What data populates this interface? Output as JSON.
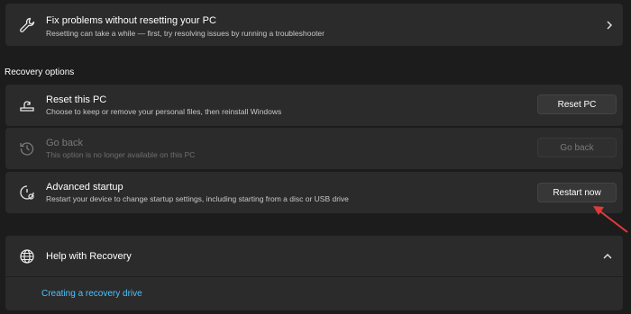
{
  "fix_problems": {
    "title": "Fix problems without resetting your PC",
    "subtitle": "Resetting can take a while — first, try resolving issues by running a troubleshooter",
    "icon": "wrench-icon"
  },
  "recovery_options_label": "Recovery options",
  "items": [
    {
      "title": "Reset this PC",
      "subtitle": "Choose to keep or remove your personal files, then reinstall Windows",
      "button": "Reset PC",
      "icon": "reset-pc-icon",
      "enabled": true
    },
    {
      "title": "Go back",
      "subtitle": "This option is no longer available on this PC",
      "button": "Go back",
      "icon": "history-icon",
      "enabled": false
    },
    {
      "title": "Advanced startup",
      "subtitle": "Restart your device to change startup settings, including starting from a disc or USB drive",
      "button": "Restart now",
      "icon": "advanced-startup-icon",
      "enabled": true
    }
  ],
  "help": {
    "title": "Help with Recovery",
    "icon": "globe-icon",
    "link": "Creating a recovery drive"
  },
  "colors": {
    "background": "#1c1c1c",
    "card": "#2b2b2b",
    "link": "#4cc2ff",
    "annotation_arrow": "#e03a3a"
  }
}
